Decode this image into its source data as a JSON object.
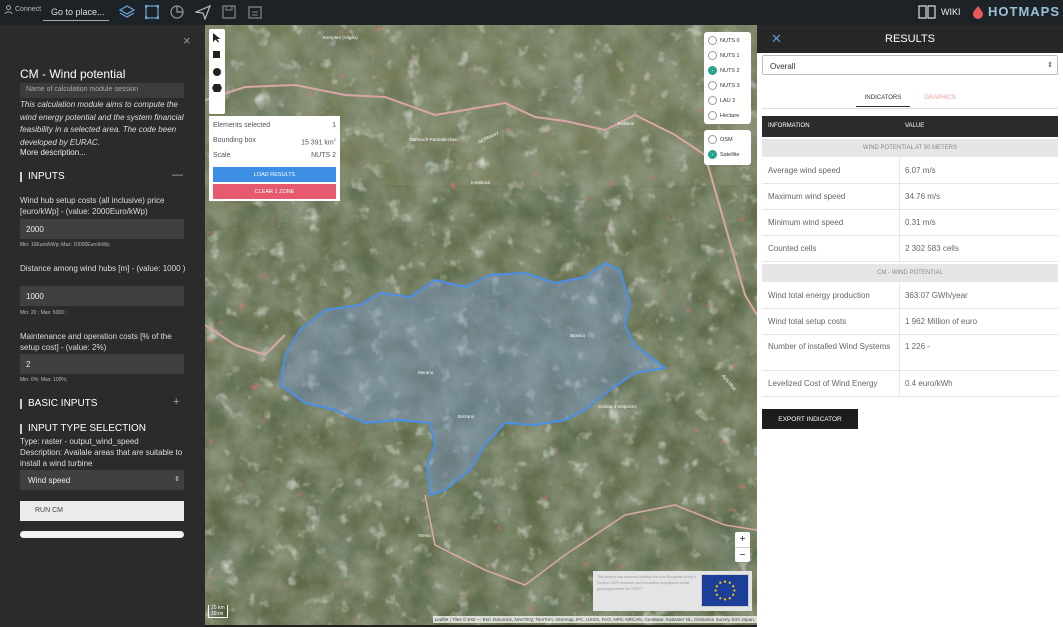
{
  "topbar": {
    "login_label": "Connect",
    "goto_label": "Go to place...",
    "wiki_label": "WIKI",
    "logo_text": "HOTMAPS",
    "icons": [
      "layers-icon",
      "selection-frame-icon",
      "chart-icon",
      "send-icon",
      "save-icon",
      "folder-icon"
    ]
  },
  "left": {
    "title": "CM - Wind potential",
    "session_placeholder": "Name of calculation module session",
    "description": "This calculation module aims to compute the wind energy potential and the system financial feasibility in a selected area. The code been developed by EURAC.",
    "more": "More description...",
    "inputs_title": "INPUTS",
    "inputs_toggle": "—",
    "inputs": [
      {
        "label": "Wind hub setup costs (all inclusive) price [euro/kWp] - (value: 2000Euro/kWp)",
        "value": "2000",
        "hint": "Min: 10Euro/kWp; Max: 10000Euro/kWp;"
      },
      {
        "label": "Distance among wind hubs [m] - (value: 1000 )",
        "value": "1000",
        "hint": "Min: 20 ; Max: 5000 ;"
      },
      {
        "label": "Maintenance and operation costs [% of the setup cost] - (value: 2%)",
        "value": "2",
        "hint": "Min: 0%; Max: 100%;"
      }
    ],
    "basic_title": "BASIC INPUTS",
    "basic_toggle": "+",
    "input_type_title": "INPUT TYPE SELECTION",
    "type_text": "Type: raster - output_wind_speed",
    "type_desc": "Description: Availale areas that are suitable to install a wind turbine",
    "type_selected": "Wind speed",
    "run_label": "RUN CM"
  },
  "map": {
    "info": {
      "elements_label": "Elements selected",
      "elements_value": "1",
      "bbox_label": "Bounding box",
      "bbox_value": "15 391 km",
      "scale_label": "Scale",
      "scale_value": "NUTS 2"
    },
    "load_label": "LOAD RESULTS",
    "clear_label": "CLEAR 1 ZONE",
    "nuts": [
      "NUTS 0",
      "NUTS 1",
      "NUTS 2",
      "NUTS 3",
      "LAU 2",
      "Hectare"
    ],
    "nuts_selected": "NUTS 2",
    "bases": [
      "OSM",
      "Satellite"
    ],
    "base_selected": "Satellite",
    "zoom_in": "+",
    "zoom_out": "−",
    "scale_km": "20 km",
    "scale_mi": "10 mi",
    "eu_text": "This project has received funding from the European Union's Horizon 2020 research and innovation programme under grant agreement No 723677",
    "attribution": "Leaflet | Tiles © Esri — Esri, DeLorme, NAVTEQ, TomTom, Intermap, iPC, USGS, FAO, NPS, NRCAN, GeoBase, Kadaster NL, Ordnance Survey, Esri Japan,",
    "places": [
      "Kempten (Allgäu)",
      "Garmisch-Partenkirchen",
      "Innsbruck",
      "Kufstein",
      "Bolzano",
      "Merano",
      "Trento",
      "Brunico",
      "Cortina d'Ampezzo",
      "GERMANY",
      "AUSTRIA"
    ]
  },
  "results": {
    "title": "RESULTS",
    "scope": "Overall",
    "tab_indicators": "INDICATORS",
    "tab_graphics": "GRAPHICS",
    "col_information": "INFORMATION",
    "col_value": "VALUE",
    "group1": "WIND POTENTIAL AT 50 METERS",
    "rows1": [
      {
        "info": "Average wind speed",
        "value": "6.07 m/s"
      },
      {
        "info": "Maximum wind speed",
        "value": "34.76 m/s"
      },
      {
        "info": "Minimum wind speed",
        "value": "0.31 m/s"
      },
      {
        "info": "Counted cells",
        "value": "2 302 583 cells"
      }
    ],
    "group2": "CM - WIND POTENTIAL",
    "rows2": [
      {
        "info": "Wind total energy production",
        "value": "363.07 GWh/year"
      },
      {
        "info": "Wind total setup costs",
        "value": "1 962 Million of euro"
      },
      {
        "info": "Number of installed Wind Systems",
        "value": "1 226 -"
      },
      {
        "info": "Levelized Cost of Wind Energy",
        "value": "0.4 euro/kWh"
      }
    ],
    "export_label": "EXPORT INDICATOR"
  },
  "colors": {
    "accent_blue": "#3d8fe6",
    "accent_red": "#e65a70",
    "radio_on": "#21a08a",
    "region_outline": "#4a8fe8"
  }
}
